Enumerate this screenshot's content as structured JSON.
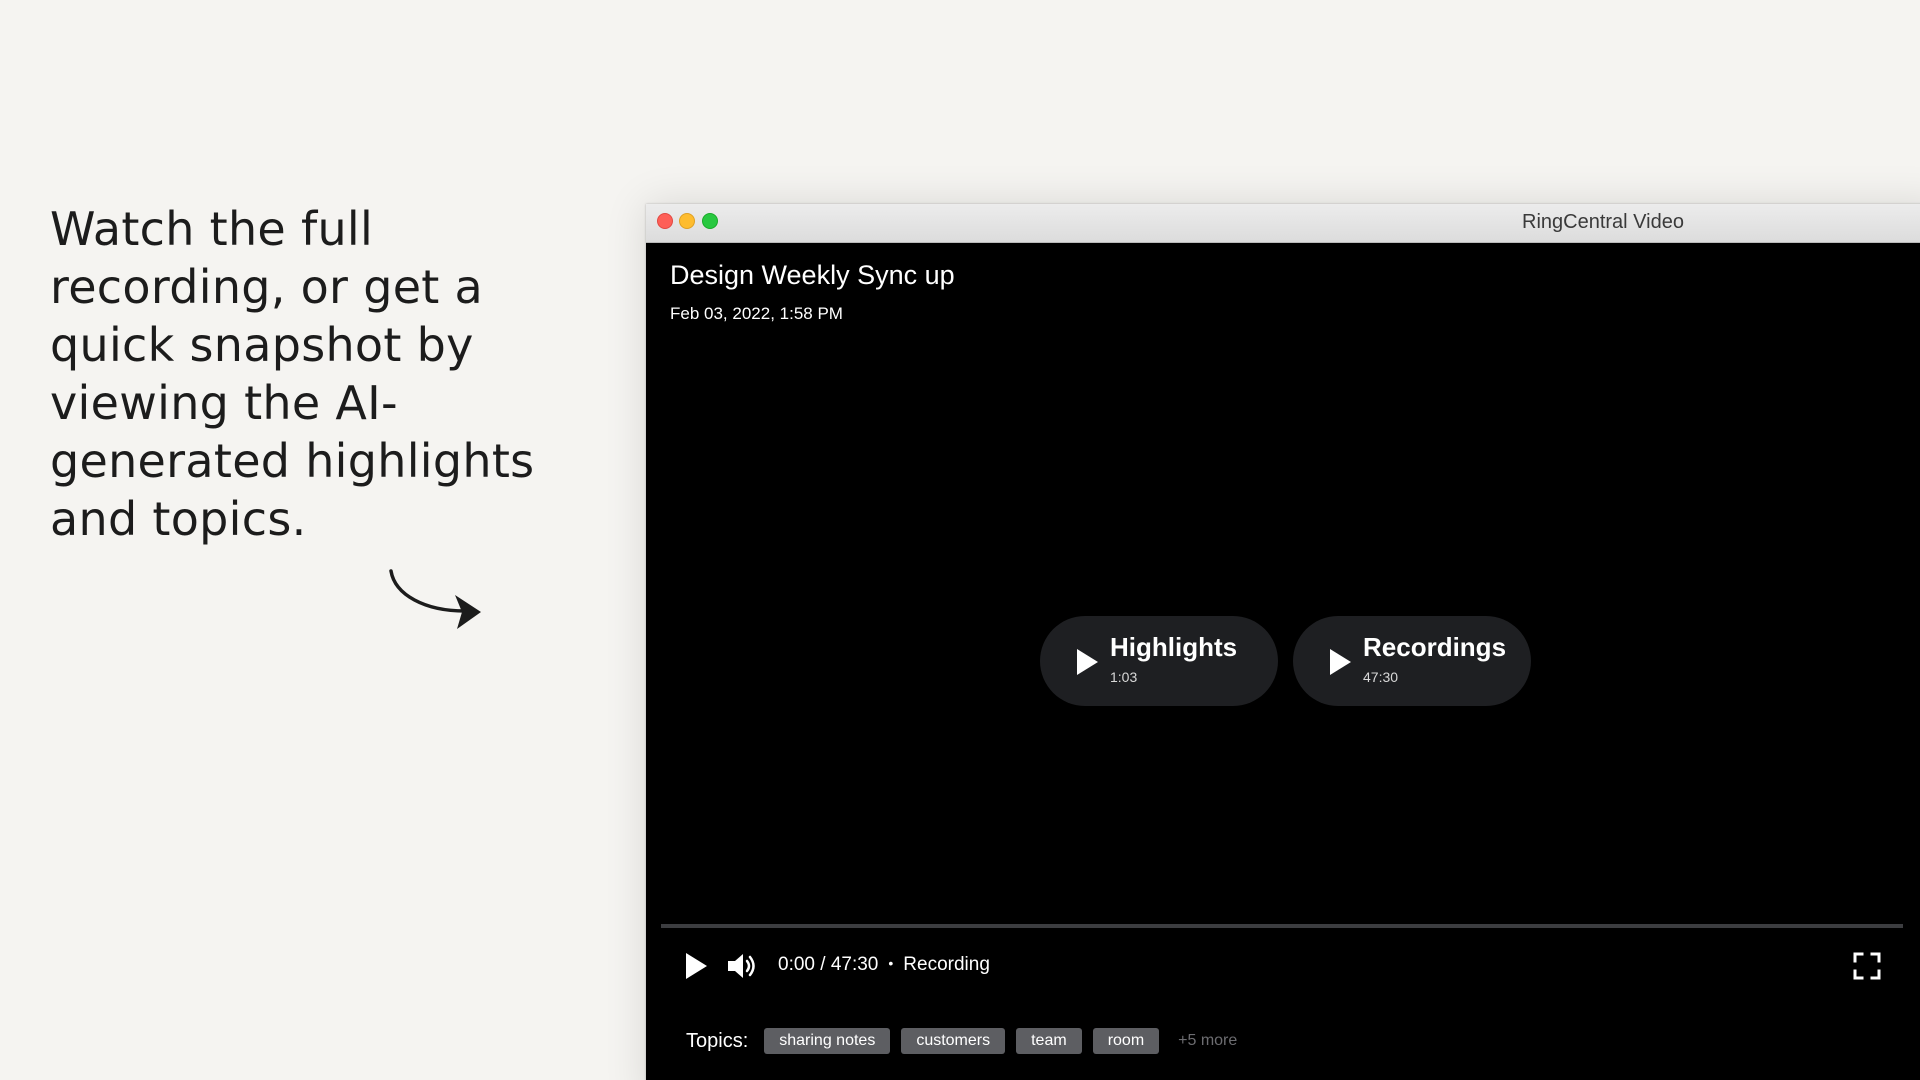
{
  "headline": "Watch the full recording, or get a quick snapshot by viewing the AI-generated highlights and topics.",
  "window": {
    "app_title": "RingCentral Video",
    "traffic_lights": [
      "close-button",
      "minimize-button",
      "maximize-button"
    ]
  },
  "meeting": {
    "title": "Design Weekly Sync up",
    "date": "Feb 03, 2022, 1:58 PM"
  },
  "options": [
    {
      "label": "Highlights",
      "duration": "1:03",
      "icon": "play-icon"
    },
    {
      "label": "Recordings",
      "duration": "47:30",
      "icon": "play-icon"
    }
  ],
  "player": {
    "time": "0:00 / 47:30",
    "separator": "•",
    "mode": "Recording",
    "progress_percent": 0,
    "icons": [
      "play-icon",
      "volume-icon",
      "fullscreen-icon"
    ]
  },
  "topics": {
    "label": "Topics:",
    "chips": [
      "sharing notes",
      "customers",
      "team",
      "room"
    ],
    "more": "+5 more"
  },
  "colors": {
    "page_background": "#f5f4f1",
    "video_background": "#000000",
    "pill_background": "#1e1f22",
    "chip_background": "#5d5e62"
  }
}
